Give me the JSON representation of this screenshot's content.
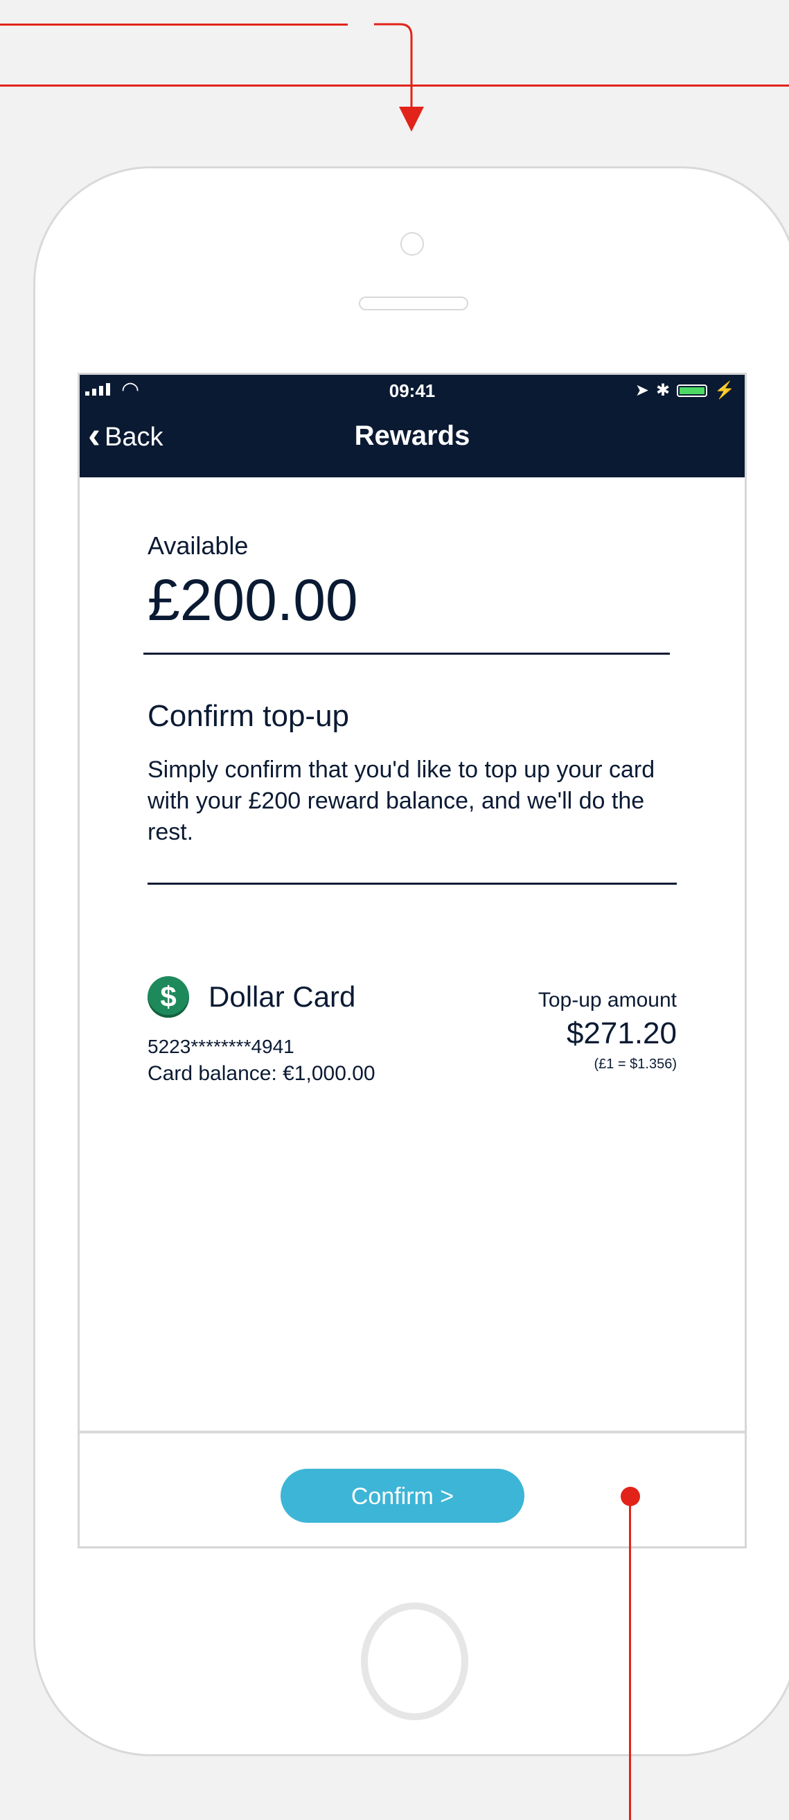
{
  "status_bar": {
    "time": "09:41"
  },
  "nav": {
    "back_label": "Back",
    "title": "Rewards"
  },
  "available": {
    "label": "Available",
    "amount": "£200.00"
  },
  "confirm_section": {
    "title": "Confirm top-up",
    "body": "Simply confirm that you'd like to top up your card with your £200 reward balance, and we'll do the rest."
  },
  "card": {
    "icon": "dollar-icon",
    "icon_glyph": "$",
    "name": "Dollar Card",
    "number": "5223********4941",
    "balance": "Card balance: €1,000.00"
  },
  "topup": {
    "label": "Top-up amount",
    "amount": "$271.20",
    "rate": "(£1 = $1.356)"
  },
  "footer": {
    "confirm_label": "Confirm >"
  },
  "colors": {
    "nav_bg": "#0b1a33",
    "accent": "#3db5d6",
    "annotation": "#e2231a",
    "card_icon": "#1e8a5c"
  }
}
